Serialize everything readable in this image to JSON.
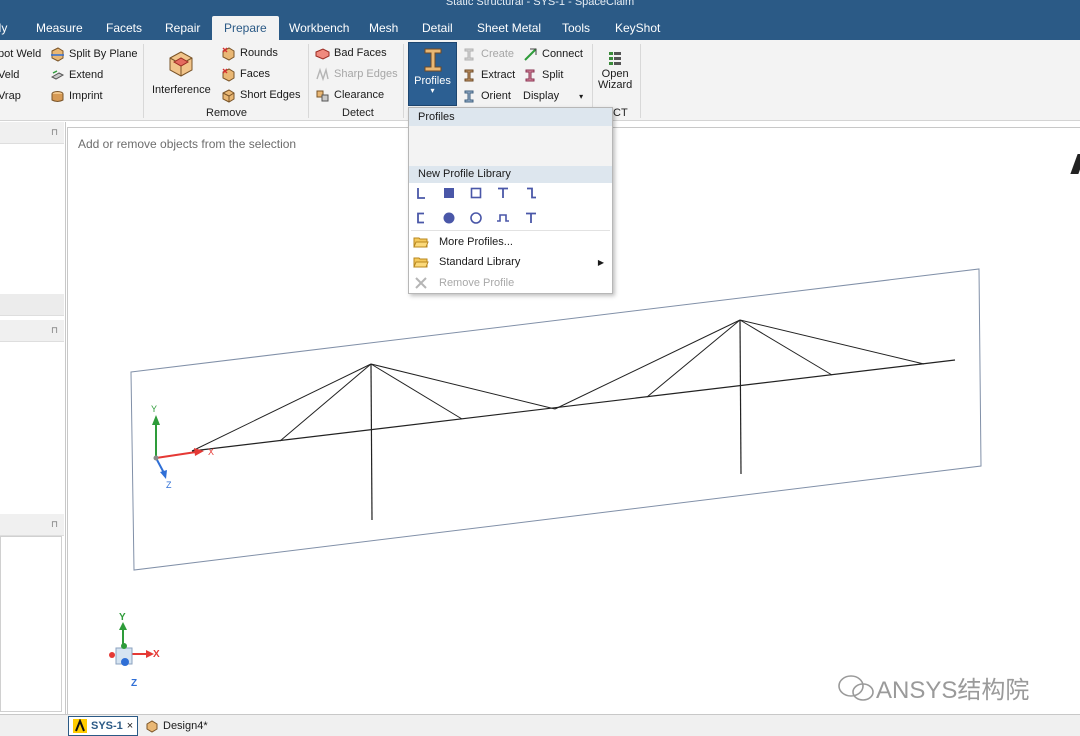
{
  "window": {
    "title": "Static Structural - SYS-1 - SpaceClaim"
  },
  "menu_tabs": [
    "bly",
    "Measure",
    "Facets",
    "Repair",
    "Prepare",
    "Workbench",
    "Mesh",
    "Detail",
    "Sheet Metal",
    "Tools",
    "KeyShot"
  ],
  "active_tab": "Prepare",
  "ribbon": {
    "left_partial": [
      "pot Weld",
      "Veld",
      "Vrap"
    ],
    "split_by_plane": "Split By Plane",
    "extend": "Extend",
    "imprint": "Imprint",
    "interference": "Interference",
    "rounds": "Rounds",
    "faces": "Faces",
    "short_edges": "Short Edges",
    "remove_group": "Remove",
    "bad_faces": "Bad Faces",
    "sharp_edges": "Sharp Edges",
    "clearance": "Clearance",
    "detect_group": "Detect",
    "profiles": "Profiles",
    "create": "Create",
    "extract": "Extract",
    "orient": "Orient",
    "connect": "Connect",
    "split": "Split",
    "display": "Display",
    "open_wizard_1": "Open",
    "open_wizard_2": "Wizard",
    "partial_group": "CT"
  },
  "dropdown": {
    "header": "Profiles",
    "library_header": "New Profile Library",
    "shapes_row1": [
      "L-angle",
      "solid-rectangle",
      "hollow-rectangle",
      "T-section",
      "Z-section"
    ],
    "shapes_row2": [
      "C-channel",
      "solid-circle",
      "hollow-circle",
      "hat-section",
      "I-section"
    ],
    "more_profiles": "More Profiles...",
    "standard_library": "Standard Library",
    "remove_profile": "Remove Profile"
  },
  "viewport": {
    "hint": "Add or remove objects from the selection",
    "axis_labels": {
      "x": "X",
      "y": "Y",
      "z": "Z"
    }
  },
  "doc_tabs": [
    {
      "label": "SYS-1",
      "close": "×"
    },
    {
      "label": "Design4*"
    }
  ],
  "watermark": "ANSYS结构院",
  "colors": {
    "accent": "#2b5a86",
    "annotation_arrow": "#e53935",
    "axis_x": "#e53935",
    "axis_y": "#2e9c3a",
    "axis_z": "#2f6fd6"
  }
}
